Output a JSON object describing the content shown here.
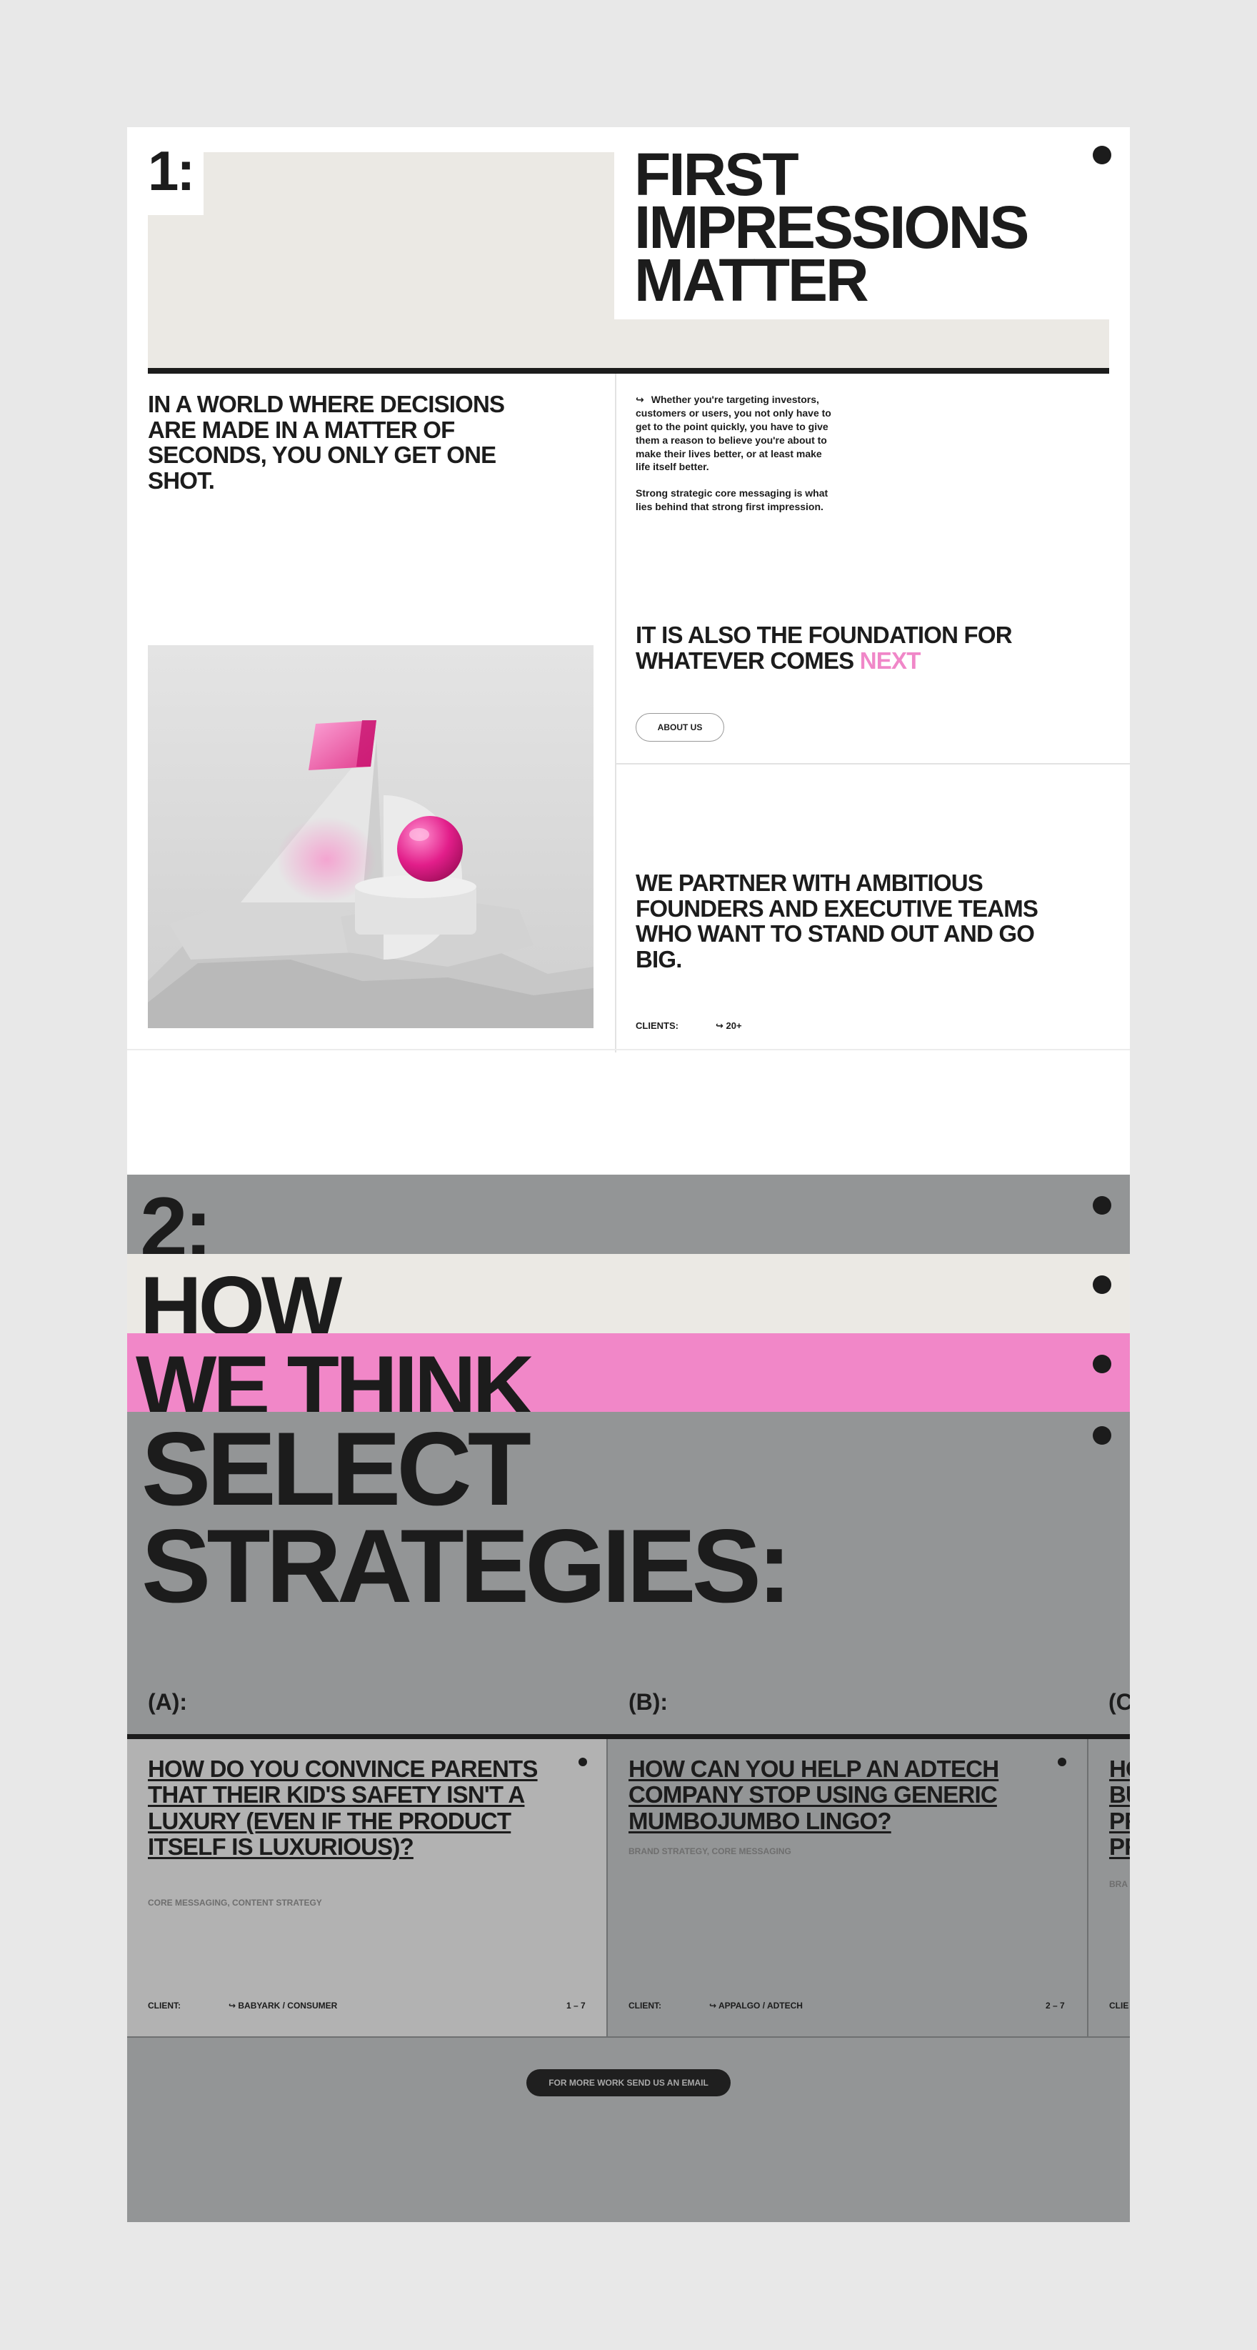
{
  "section1": {
    "number": "1:",
    "title": "FIRST IMPRESSIONS MATTER",
    "lead": "IN A WORLD WHERE DECISIONS ARE MADE IN A MATTER OF SECONDS, YOU ONLY GET ONE SHOT.",
    "arrow": "↪",
    "body_p1": "Whether you're targeting investors, customers or users, you not only have to get to the point quickly, you have to give them a reason to believe you're about to make their lives better, or at least make life itself better.",
    "body_p2": "Strong strategic core messaging is what lies behind that strong first impression.",
    "also_text": "IT IS ALSO THE FOUNDATION FOR WHATEVER COMES",
    "also_highlight": "NEXT",
    "about_button": "ABOUT US",
    "partner_text": "WE PARTNER WITH AMBITIOUS FOUNDERS AND EXECUTIVE TEAMS WHO WANT TO STAND OUT AND GO BIG.",
    "clients_label": "CLIENTS:",
    "clients_value": "↪  20+"
  },
  "section2": {
    "number": "2:",
    "word1": "HOW",
    "word2": "WE THINK",
    "heading": "SELECT STRATEGIES:",
    "columns": [
      {
        "label": "(A):",
        "title": "HOW DO YOU CONVINCE PARENTS THAT THEIR KID'S SAFETY ISN'T A LUXURY (EVEN IF THE PRODUCT ITSELF IS LUXURIOUS)?",
        "tags": "CORE MESSAGING, CONTENT STRATEGY",
        "client_label": "CLIENT:",
        "client": "↪  BABYARK / CONSUMER",
        "pages": "1 – 7"
      },
      {
        "label": "(B):",
        "title": "HOW CAN YOU HELP AN ADTECH COMPANY STOP USING GENERIC MUMBOJUMBO LINGO?",
        "tags": "BRAND STRATEGY, CORE MESSAGING",
        "client_label": "CLIENT:",
        "client": "↪  APPALGO / ADTECH",
        "pages": "2 – 7"
      },
      {
        "label": "(C",
        "title": "HO BU PR PR",
        "tags": "BRA",
        "client_label": "CLIE"
      }
    ],
    "more_button": "FOR MORE WORK SEND US AN EMAIL"
  },
  "colors": {
    "beige": "#ebe9e4",
    "pink": "#f087c8",
    "grey": "#939596",
    "dark": "#1c1c1c"
  },
  "icons": [
    "dot-icon",
    "arrow-hook-icon"
  ]
}
